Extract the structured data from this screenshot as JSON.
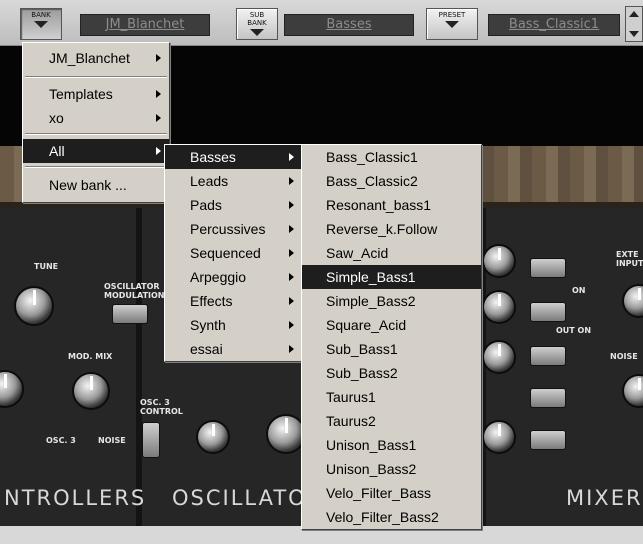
{
  "toolbar": {
    "bank_label": "BANK",
    "bank_value": "JM_Blanchet",
    "subbank_label": "SUB BANK",
    "subbank_value": "Basses",
    "preset_label": "PRESET",
    "preset_value": "Bass_Classic1"
  },
  "panel": {
    "sections": [
      "NTROLLERS",
      "OSCILLATOR",
      "MIXER"
    ],
    "labels": {
      "tune": "TUNE",
      "oscillator_modulation": "OSCILLATOR MODULATION",
      "mod_mix": "MOD. MIX",
      "osc3": "OSC. 3",
      "noise": "NOISE",
      "osc3_control": "OSC. 3 CONTROL",
      "ext_input": "EXTE INPUT",
      "noise_right": "NOISE",
      "on": "ON",
      "out_on": "OUT ON"
    }
  },
  "bank_menu": {
    "items": [
      {
        "label": "JM_Blanchet",
        "submenu": true
      },
      {
        "label": "Templates",
        "submenu": true
      },
      {
        "label": "xo",
        "submenu": true
      },
      {
        "label": "All",
        "submenu": true,
        "highlighted": true
      },
      {
        "label": "New bank ...",
        "submenu": false
      }
    ]
  },
  "category_menu": {
    "items": [
      {
        "label": "Basses",
        "highlighted": true
      },
      {
        "label": "Leads"
      },
      {
        "label": "Pads"
      },
      {
        "label": "Percussives"
      },
      {
        "label": "Sequenced"
      },
      {
        "label": "Arpeggio"
      },
      {
        "label": "Effects"
      },
      {
        "label": "Synth"
      },
      {
        "label": "essai"
      }
    ]
  },
  "preset_menu": {
    "items": [
      "Bass_Classic1",
      "Bass_Classic2",
      "Resonant_bass1",
      "Reverse_k.Follow",
      "Saw_Acid",
      "Simple_Bass1",
      "Simple_Bass2",
      "Square_Acid",
      "Sub_Bass1",
      "Sub_Bass2",
      "Taurus1",
      "Taurus2",
      "Unison_Bass1",
      "Unison_Bass2",
      "Velo_Filter_Bass",
      "Velo_Filter_Bass2"
    ],
    "highlighted_index": 5
  },
  "colors": {
    "menu_bg": "#d4d0c8",
    "highlight_bg": "#1e1e1e",
    "lcd_bg": "#3d3d3d",
    "lcd_text": "#8c8c8c"
  }
}
